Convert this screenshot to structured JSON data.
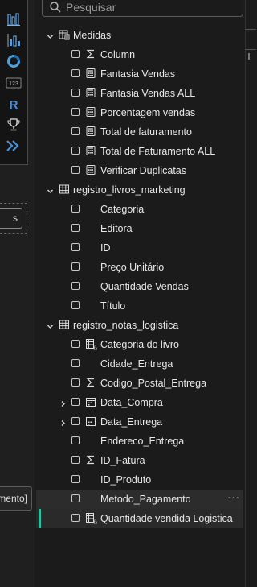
{
  "search": {
    "placeholder": "Pesquisar",
    "value": ""
  },
  "tooltip": {
    "text": "[Metodo_Pagamento]"
  },
  "mini_button": {
    "label": "s"
  },
  "viz_icons": [
    "clustered-column-chart-icon",
    "stacked-bar-chart-icon",
    "donut-chart-icon",
    "card-number-icon",
    "r-visual-icon",
    "trophy-icon",
    "chevron-flow-icon"
  ],
  "viz_icon_text": {
    "card": "123",
    "r": "R"
  },
  "tables": [
    {
      "name": "Medidas",
      "expanded": true,
      "icon": "measure-table-icon",
      "fields": [
        {
          "label": "Column",
          "icon": "sigma-icon"
        },
        {
          "label": "Fantasia Vendas",
          "icon": "calculator-icon"
        },
        {
          "label": "Fantasia Vendas ALL",
          "icon": "calculator-icon"
        },
        {
          "label": "Porcentagem vendas",
          "icon": "calculator-icon"
        },
        {
          "label": "Total de faturamento",
          "icon": "calculator-icon"
        },
        {
          "label": "Total de Faturamento ALL",
          "icon": "calculator-icon"
        },
        {
          "label": "Verificar Duplicatas",
          "icon": "calculator-icon"
        }
      ]
    },
    {
      "name": "registro_livros_marketing",
      "expanded": true,
      "icon": "table-icon",
      "fields": [
        {
          "label": "Categoria",
          "icon": ""
        },
        {
          "label": "Editora",
          "icon": ""
        },
        {
          "label": "ID",
          "icon": ""
        },
        {
          "label": "Preço Unitário",
          "icon": ""
        },
        {
          "label": "Quantidade Vendas",
          "icon": ""
        },
        {
          "label": "Título",
          "icon": ""
        }
      ]
    },
    {
      "name": "registro_notas_logistica",
      "expanded": true,
      "icon": "table-icon",
      "fields": [
        {
          "label": "Categoria do livro",
          "icon": "calculated-column-icon"
        },
        {
          "label": "Cidade_Entrega",
          "icon": ""
        },
        {
          "label": "Codigo_Postal_Entrega",
          "icon": "sigma-icon"
        },
        {
          "label": "Data_Compra",
          "icon": "calendar-icon",
          "expandable": true
        },
        {
          "label": "Data_Entrega",
          "icon": "calendar-icon",
          "expandable": true
        },
        {
          "label": "Endereco_Entrega",
          "icon": ""
        },
        {
          "label": "ID_Fatura",
          "icon": "sigma-icon"
        },
        {
          "label": "ID_Produto",
          "icon": ""
        },
        {
          "label": "Metodo_Pagamento",
          "icon": "",
          "hover": true,
          "more": "···"
        },
        {
          "label": "Quantidade vendida Logistica",
          "icon": "calculated-column-icon",
          "selected": true
        }
      ]
    }
  ]
}
